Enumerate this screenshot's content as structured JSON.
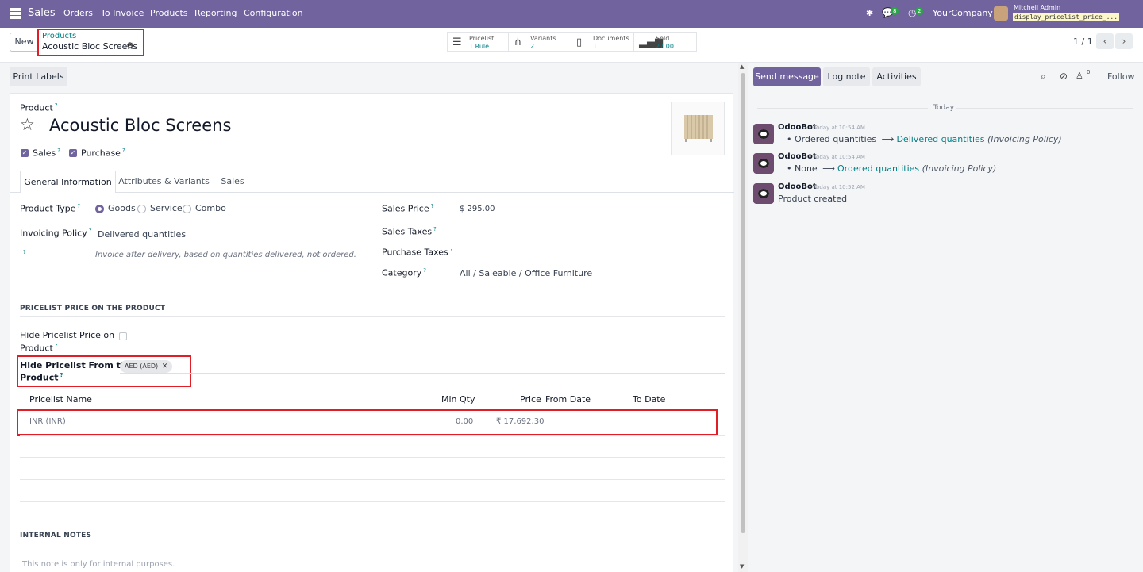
{
  "navbar": {
    "app_name": "Sales",
    "menu": [
      "Orders",
      "To Invoice",
      "Products",
      "Reporting",
      "Configuration"
    ],
    "messages_badge": "8",
    "activity_badge": "2",
    "company": "YourCompany",
    "user_name": "Mitchell Admin",
    "db_name": "display_pricelist_price_..."
  },
  "control_panel": {
    "new_label": "New",
    "breadcrumb_parent": "Products",
    "breadcrumb_current": "Acoustic Bloc Screens",
    "stats": [
      {
        "label": "Pricelist",
        "value": "1 Rule",
        "icon": "list-icon"
      },
      {
        "label": "Variants",
        "value": "2",
        "icon": "sitemap-icon"
      },
      {
        "label": "Documents",
        "value": "1",
        "icon": "file-icon"
      },
      {
        "label": "Sold",
        "value": "27.00",
        "icon": "bar-chart-icon"
      }
    ],
    "pager": "1 / 1"
  },
  "form": {
    "print_labels": "Print Labels",
    "product_label": "Product",
    "product_name": "Acoustic Bloc Screens",
    "sales_label": "Sales",
    "purchase_label": "Purchase",
    "tabs": [
      "General Information",
      "Attributes & Variants",
      "Sales"
    ],
    "product_type_label": "Product Type",
    "product_type_options": [
      "Goods",
      "Service",
      "Combo"
    ],
    "invoicing_policy_label": "Invoicing Policy",
    "invoicing_policy_value": "Delivered quantities",
    "invoicing_policy_help": "Invoice after delivery, based on quantities delivered, not ordered.",
    "sales_price_label": "Sales Price",
    "sales_price_value": "$ 295.00",
    "sales_taxes_label": "Sales Taxes",
    "purchase_taxes_label": "Purchase Taxes",
    "category_label": "Category",
    "category_value": "All / Saleable / Office Furniture",
    "pricelist_section": "PRICELIST PRICE ON THE PRODUCT",
    "hide_price_label_1": "Hide Pricelist Price on",
    "hide_price_label_2": "Product",
    "hide_from_label_1": "Hide Pricelist From the",
    "hide_from_label_2": "Product",
    "hide_from_tag": "AED (AED)",
    "table_headers": {
      "name": "Pricelist Name",
      "min_qty": "Min Qty",
      "price": "Price",
      "from_date": "From Date",
      "to_date": "To Date"
    },
    "table_rows": [
      {
        "name": "INR (INR)",
        "min_qty": "0.00",
        "price": "₹ 17,692.30",
        "from_date": "",
        "to_date": ""
      }
    ],
    "internal_notes_section": "INTERNAL NOTES",
    "internal_notes_placeholder": "This note is only for internal purposes."
  },
  "chatter": {
    "send_message": "Send message",
    "log_note": "Log note",
    "activities": "Activities",
    "follow": "Follow",
    "followers_count": "0",
    "date_separator": "Today",
    "messages": [
      {
        "author": "OdooBot",
        "time": "Today at 10:54 AM",
        "old": "Ordered quantities",
        "new": "Delivered quantities",
        "field": "(Invoicing Policy)"
      },
      {
        "author": "OdooBot",
        "time": "Today at 10:54 AM",
        "old": "None",
        "new": "Ordered quantities",
        "field": "(Invoicing Policy)"
      },
      {
        "author": "OdooBot",
        "time": "Today at 10:52 AM",
        "body": "Product created"
      }
    ]
  },
  "colors": {
    "brand": "#71639e",
    "link": "#017e84",
    "highlight": "#e11d26"
  }
}
